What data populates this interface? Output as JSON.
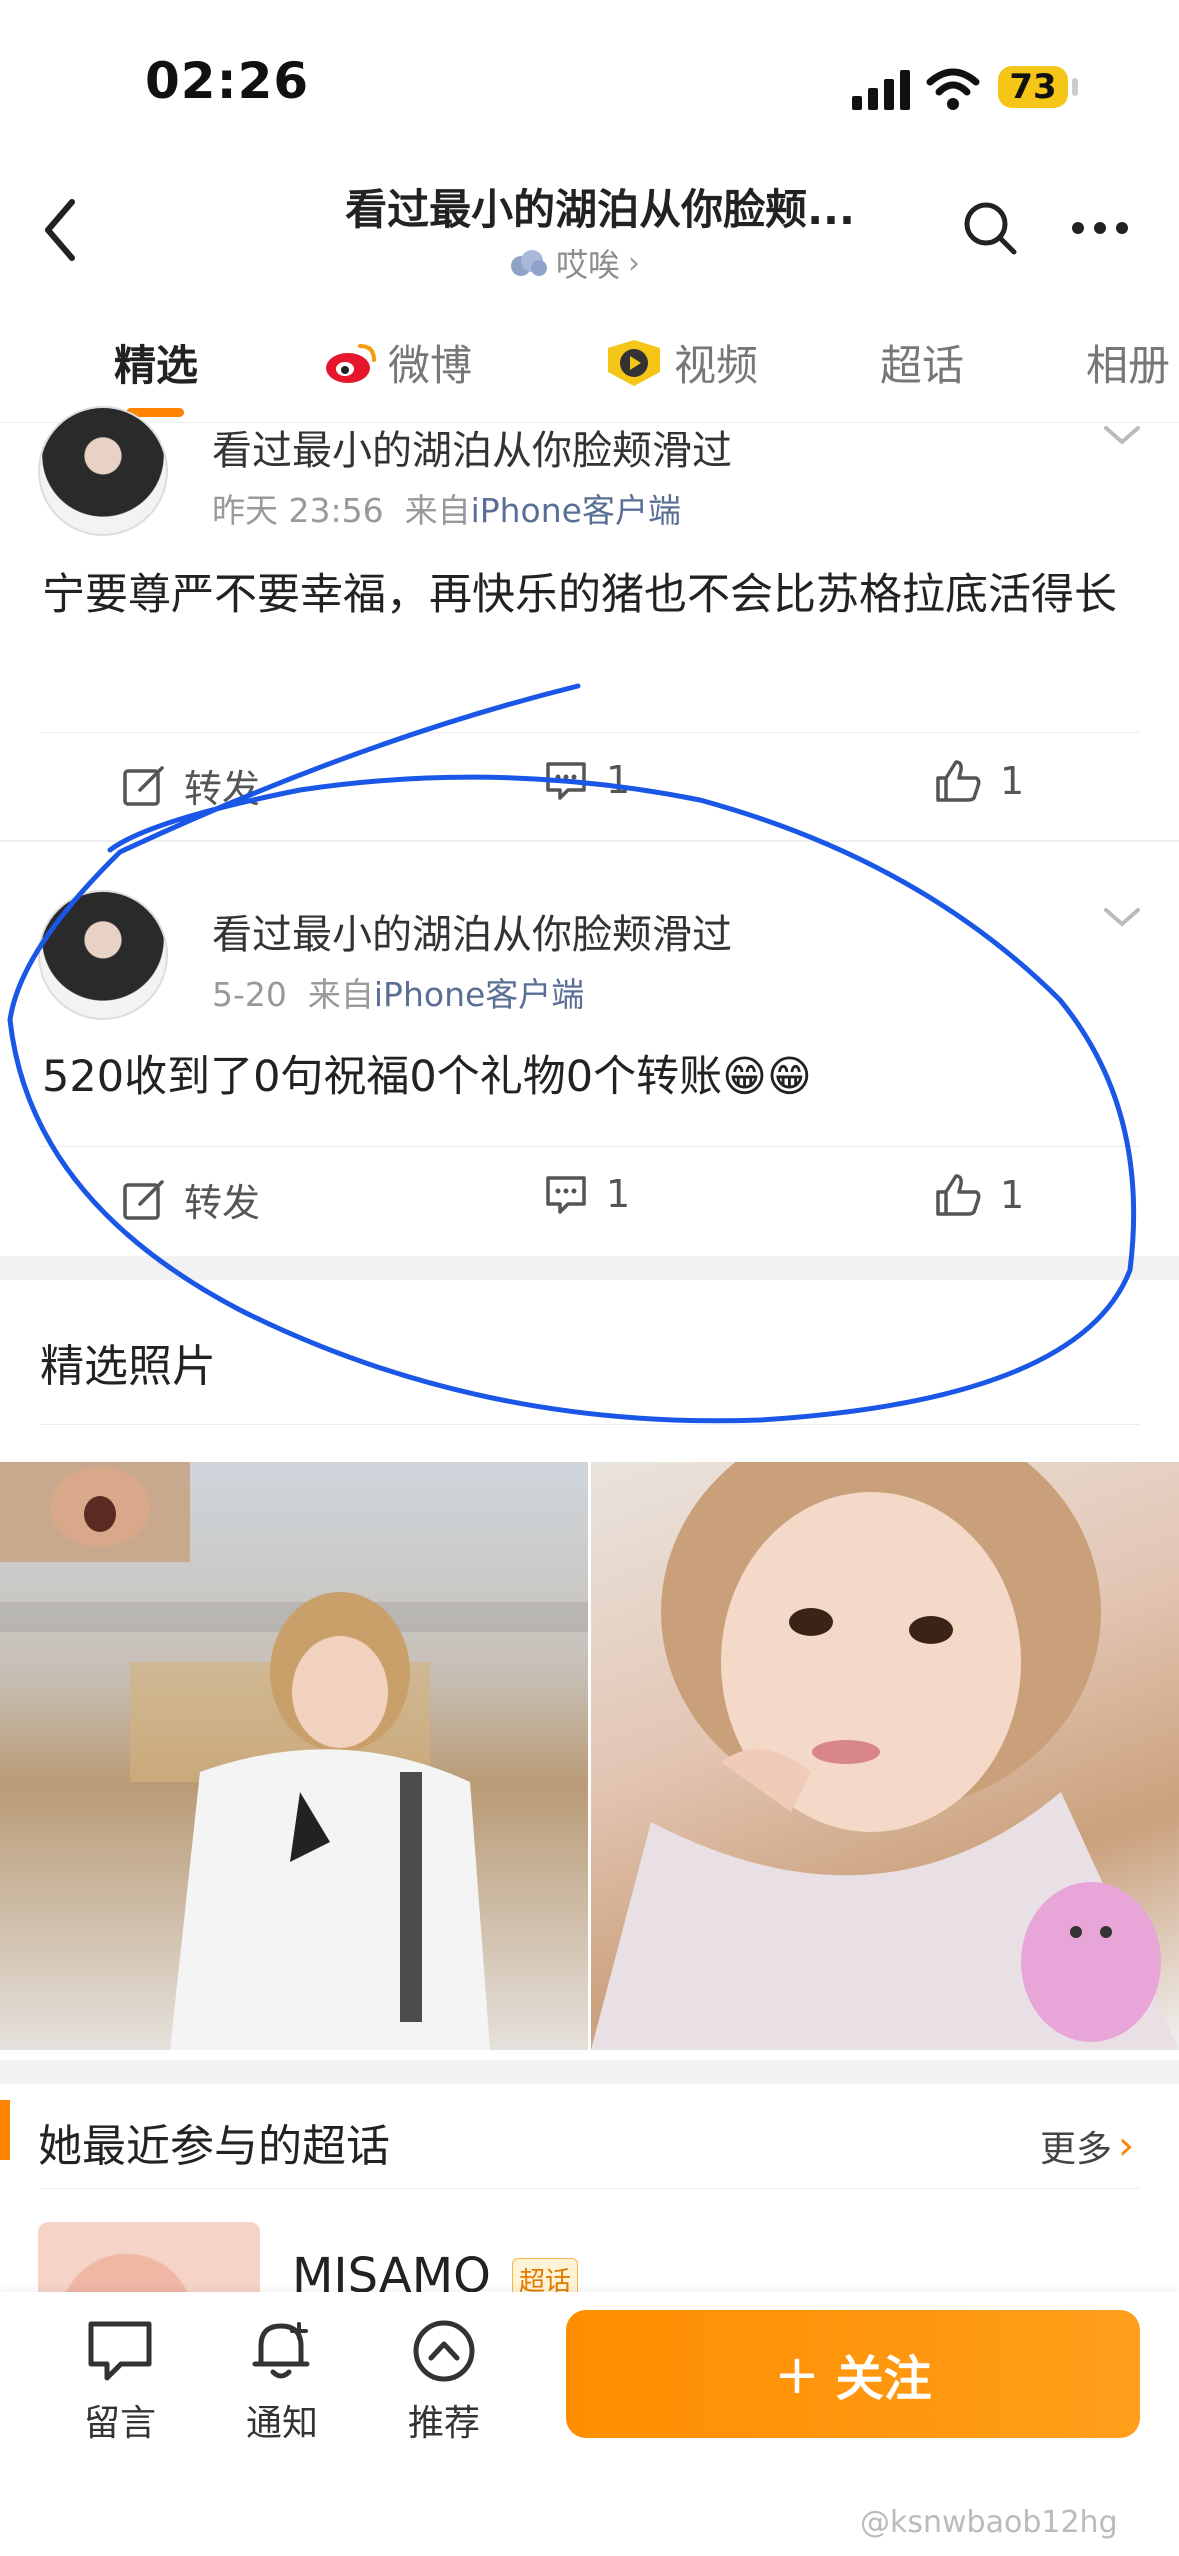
{
  "status_bar": {
    "time": "02:26",
    "battery": "73"
  },
  "header": {
    "title": "看过最小的湖泊从你脸颊...",
    "subtitle": "哎唉"
  },
  "tabs": [
    {
      "label": "精选",
      "active": true
    },
    {
      "label": "微博",
      "active": false
    },
    {
      "label": "视频",
      "active": false
    },
    {
      "label": "超话",
      "active": false
    },
    {
      "label": "相册",
      "active": false
    }
  ],
  "posts": [
    {
      "name": "看过最小的湖泊从你脸颊滑过",
      "time": "昨天 23:56",
      "from": "来自",
      "source": "iPhone客户端",
      "text": "宁要尊严不要幸福，再快乐的猪也不会比苏格拉底活得长",
      "repost_label": "转发",
      "comments": "1",
      "likes": "1"
    },
    {
      "name": "看过最小的湖泊从你脸颊滑过",
      "time": "5-20",
      "from": "来自",
      "source": "iPhone客户端",
      "text": "520收到了0句祝福0个礼物0个转账😁😁",
      "repost_label": "转发",
      "comments": "1",
      "likes": "1"
    }
  ],
  "photos_section": {
    "title": "精选照片"
  },
  "topics_section": {
    "title": "她最近参与的超话",
    "more": "更多",
    "topic_name": "MISAMO",
    "topic_badge": "超话"
  },
  "bottom_bar": {
    "message": "留言",
    "notify": "通知",
    "recommend": "推荐",
    "follow": "关注"
  },
  "watermark": "@ksnwbaob12hg",
  "colors": {
    "accent": "#ff8200",
    "annotation": "#1a57e6",
    "link": "#5b6f96"
  },
  "icons": [
    "back-icon",
    "search-icon",
    "more-icon",
    "weibo-icon",
    "video-icon",
    "compose-icon",
    "comment-icon",
    "like-icon",
    "message-icon",
    "bell-icon",
    "up-icon"
  ]
}
